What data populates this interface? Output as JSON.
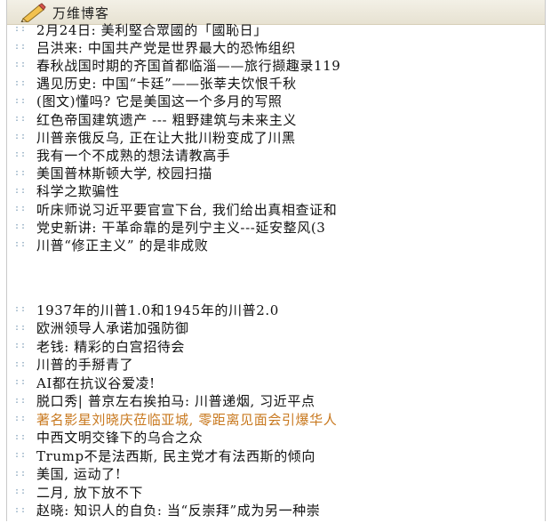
{
  "header": {
    "title": "万维博客",
    "icon": "pencil-icon"
  },
  "bullet_glyph": "::",
  "colors": {
    "link": "#111111",
    "highlight_link": "#c8781e",
    "bullet": "#7a9bb5",
    "header_bg": "#ebe6d6"
  },
  "articles": [
    {
      "text": "2月24日: 美利堅合眾國的「國恥日」",
      "highlight": false
    },
    {
      "text": "吕洪来: 中国共产党是世界最大的恐怖组织",
      "highlight": false
    },
    {
      "text": "春秋战国时期的齐国首都临淄——旅行撷趣录119",
      "highlight": false
    },
    {
      "text": "遇见历史: 中国“卡廷”——张莘夫饮恨千秋",
      "highlight": false
    },
    {
      "text": "(图文)懂吗? 它是美国这一个多月的写照",
      "highlight": false
    },
    {
      "text": "红色帝国建筑遗产 --- 粗野建筑与未来主义",
      "highlight": false
    },
    {
      "text": "川普亲俄反乌, 正在让大批川粉变成了川黑",
      "highlight": false
    },
    {
      "text": "我有一个不成熟的想法请教高手",
      "highlight": false
    },
    {
      "text": "美国普林斯顿大学, 校园扫描",
      "highlight": false
    },
    {
      "text": "科学之欺骗性",
      "highlight": false
    },
    {
      "text": "听床师说习近平要官宣下台, 我们给出真相查证和",
      "highlight": false
    },
    {
      "text": "党史新讲: 干革命靠的是列宁主义---延安整风(3",
      "highlight": false
    },
    {
      "text": "川普“修正主义” 的是非成败",
      "highlight": false
    },
    {
      "text": "1937年的川普1.0和1945年的川普2.0",
      "highlight": false
    },
    {
      "text": "欧洲领导人承诺加强防御",
      "highlight": false
    },
    {
      "text": "老钱: 精彩的白宫招待会",
      "highlight": false
    },
    {
      "text": "川普的手掰青了",
      "highlight": false
    },
    {
      "text": "AI都在抗议谷爱凌!",
      "highlight": false
    },
    {
      "text": "脱口秀| 普京左右挨拍马: 川普递烟, 习近平点",
      "highlight": false
    },
    {
      "text": "著名影星刘晓庆莅临亚城, 零距离见面会引爆华人",
      "highlight": true
    },
    {
      "text": "中西文明交锋下的乌合之众",
      "highlight": false
    },
    {
      "text": "Trump不是法西斯, 民主党才有法西斯的倾向",
      "highlight": false
    },
    {
      "text": "美国, 运动了!",
      "highlight": false
    },
    {
      "text": "二月, 放下放不下",
      "highlight": false
    },
    {
      "text": "赵晓: 知识人的自负: 当“反崇拜”成为另一种崇",
      "highlight": false
    }
  ]
}
